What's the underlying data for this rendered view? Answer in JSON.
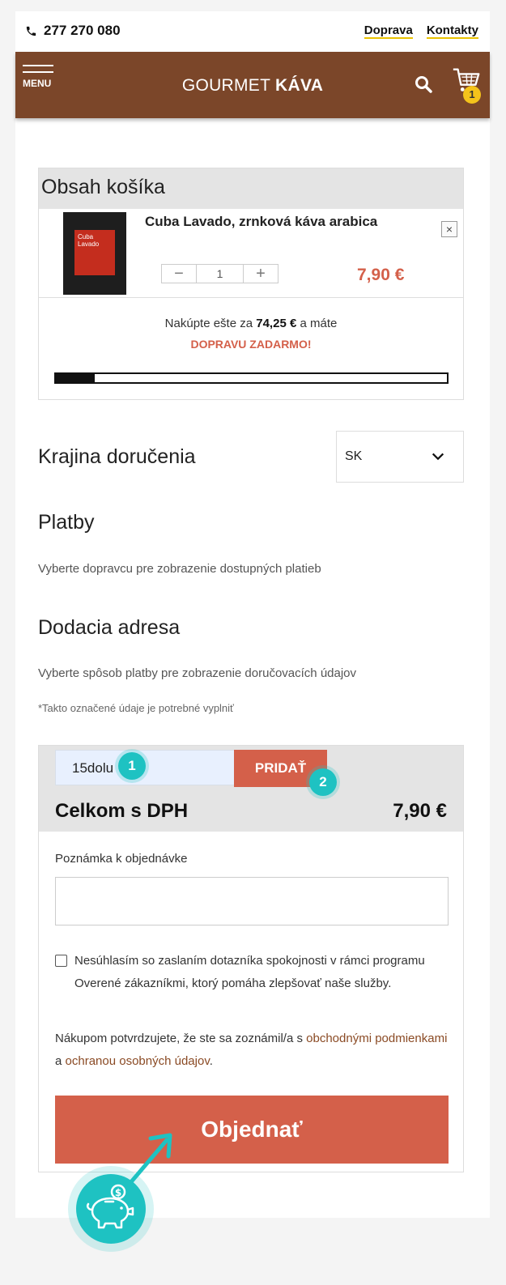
{
  "topbar": {
    "phone": "277 270 080",
    "links": [
      "Doprava",
      "Kontakty"
    ]
  },
  "header": {
    "menu_label": "MENU",
    "brand_regular": "GOURMET",
    "brand_bold": "KÁVA",
    "cart_count": "1"
  },
  "cart": {
    "title": "Obsah košíka",
    "item": {
      "name": "Cuba Lavado, zrnková káva arabica",
      "package_label": "Cuba Lavado",
      "quantity": "1",
      "minus": "−",
      "plus": "+",
      "remove": "×",
      "price": "7,90 €"
    },
    "shipping_prefix": "Nakúpte ešte za",
    "shipping_amount": "74,25 €",
    "shipping_suffix": "a máte",
    "free_shipping": "DOPRAVU ZADARMO!",
    "progress": 0.1
  },
  "delivery": {
    "title": "Krajina doručenia",
    "country": "SK"
  },
  "payments": {
    "title": "Platby",
    "info": "Vyberte dopravcu pre zobrazenie dostupných platieb"
  },
  "address": {
    "title": "Dodacia adresa",
    "info": "Vyberte spôsob platby pre zobrazenie doručovacích údajov",
    "required_note": "*Takto označené údaje je potrebné vyplniť"
  },
  "summary": {
    "coupon_value": "15dolu",
    "coupon_button": "PRIDAŤ",
    "step1": "1",
    "step2": "2",
    "total_label": "Celkom s DPH",
    "total_value": "7,90 €",
    "note_label": "Poznámka k objednávke",
    "consent": "Nesúhlasím so zaslaním dotazníka spokojnosti v rámci programu Overené zákazníkmi, ktorý pomáha zlepšovať naše služby.",
    "terms_1": "Nákupom potvrdzujete, že ste sa zoznámil/a s",
    "terms_link1": "obchodnými podmienkami",
    "terms_2": "a",
    "terms_link2": "ochranou osobných údajov",
    "terms_3": ".",
    "order_button": "Objednať"
  },
  "colors": {
    "brown": "#7b4629",
    "accent": "#d4604a",
    "teal": "#1ec2c2",
    "badge": "#f4c31b"
  }
}
